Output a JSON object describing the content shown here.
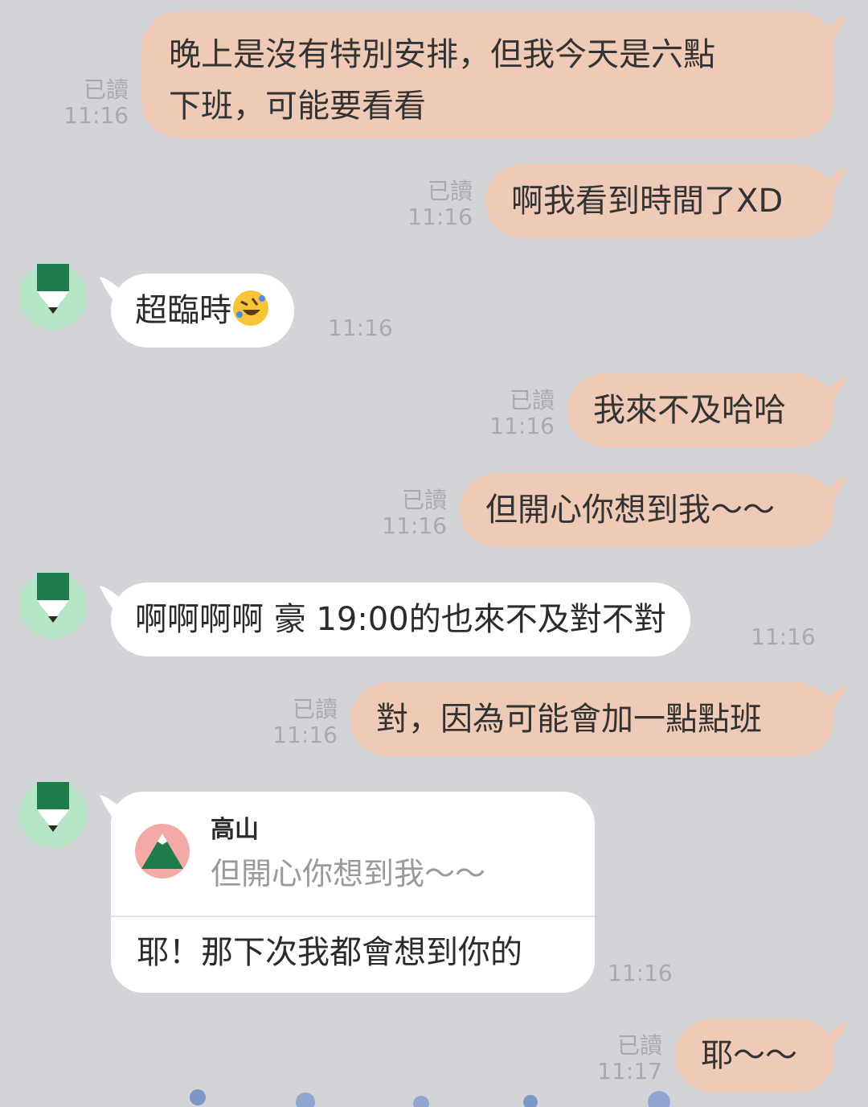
{
  "colors": {
    "background": "#d3d4d8",
    "outgoing_bubble": "#efcab6",
    "incoming_bubble": "#ffffff",
    "meta_text": "#a9aab0",
    "avatar_bg": "#b6e6c6",
    "avatar_fg": "#1f7a4c"
  },
  "messages": [
    {
      "direction": "out",
      "lines": [
        "晚上是沒有特別安排，但我今天是六點",
        "下班，可能要看看"
      ],
      "read": "已讀",
      "time": "11:16"
    },
    {
      "direction": "out",
      "text": "啊我看到時間了XD",
      "read": "已讀",
      "time": "11:16"
    },
    {
      "direction": "in",
      "text": "超臨時",
      "emoji": "rolling-on-floor-laughing-emoji",
      "time": "11:16"
    },
    {
      "direction": "out",
      "text": "我來不及哈哈",
      "read": "已讀",
      "time": "11:16"
    },
    {
      "direction": "out",
      "text": "但開心你想到我～～",
      "read": "已讀",
      "time": "11:16"
    },
    {
      "direction": "in",
      "text": "啊啊啊啊 豪 19:00的也來不及對不對",
      "time": "11:16"
    },
    {
      "direction": "out",
      "text": "對，因為可能會加一點點班",
      "read": "已讀",
      "time": "11:16"
    },
    {
      "direction": "in",
      "reply_to_name": "高山",
      "reply_to_text": "但開心你想到我～～",
      "text": "耶！那下次我都會想到你的",
      "time": "11:16"
    },
    {
      "direction": "out",
      "text": "耶～～",
      "read": "已讀",
      "time": "11:17"
    }
  ]
}
